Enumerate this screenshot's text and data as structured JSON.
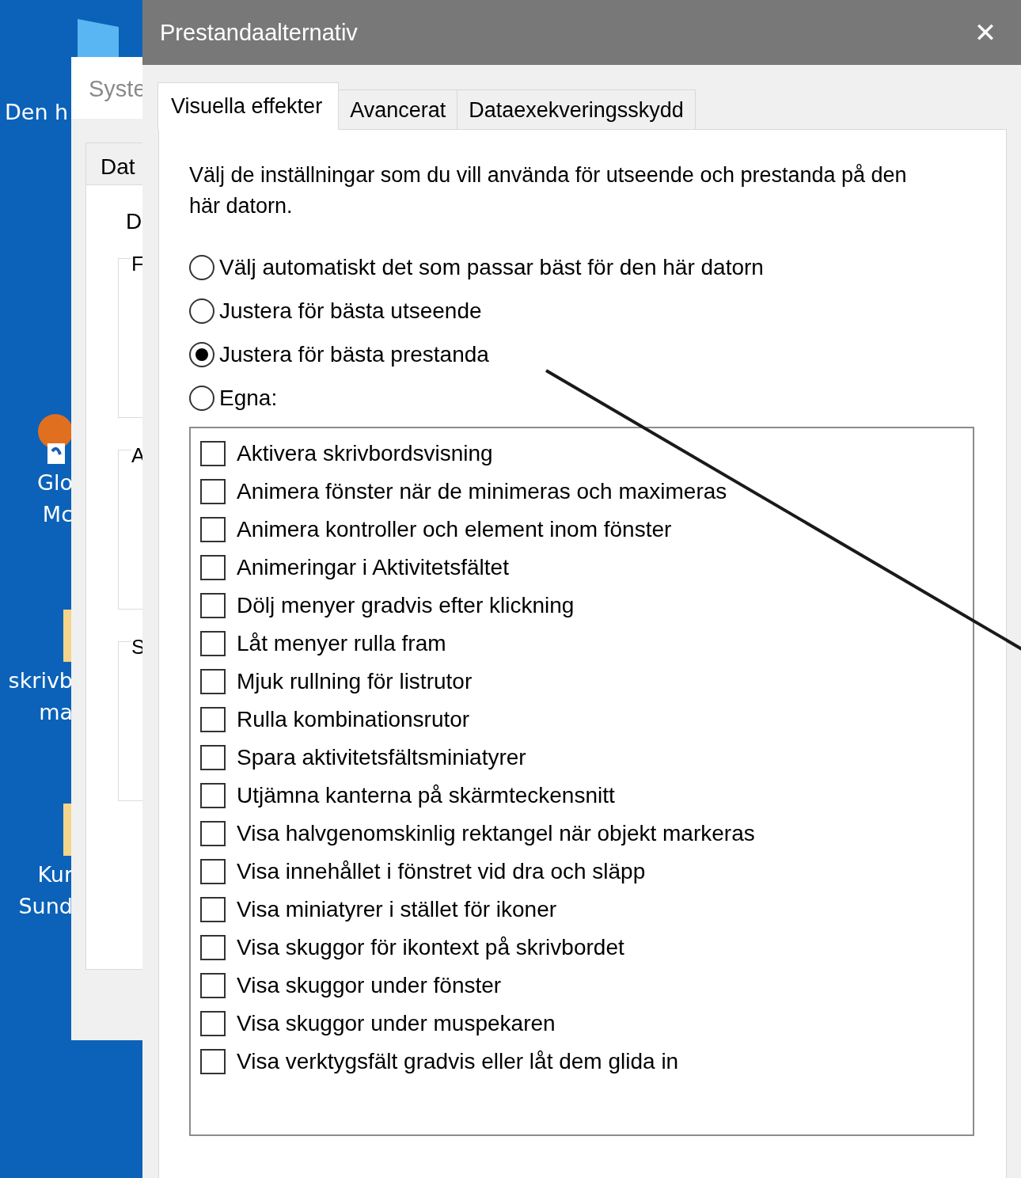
{
  "desktop": {
    "icons": [
      {
        "label": "Den h",
        "kind": "pc"
      },
      {
        "label": "Glo\nMc",
        "kind": "app"
      },
      {
        "label": "skrivb\nma",
        "kind": "folder"
      },
      {
        "label": "Kur\nSund",
        "kind": "folder"
      }
    ]
  },
  "background_window": {
    "title": "Syste",
    "tab": "Dat",
    "heading": "D",
    "groups": [
      "F",
      "A",
      "S"
    ]
  },
  "dialog": {
    "title": "Prestandaalternativ",
    "close": "✕",
    "tabs": [
      {
        "label": "Visuella effekter",
        "selected": true
      },
      {
        "label": "Avancerat",
        "selected": false
      },
      {
        "label": "Dataexekveringsskydd",
        "selected": false
      }
    ],
    "intro": "Välj de inställningar som du vill använda för utseende och prestanda på den här datorn.",
    "options": [
      {
        "label": "Välj automatiskt det som passar bäst för den här datorn",
        "selected": false
      },
      {
        "label": "Justera för bästa utseende",
        "selected": false
      },
      {
        "label": "Justera för bästa prestanda",
        "selected": true
      },
      {
        "label": "Egna:",
        "selected": false
      }
    ],
    "effects": [
      {
        "label": "Aktivera skrivbordsvisning",
        "checked": false
      },
      {
        "label": "Animera fönster när de minimeras och maximeras",
        "checked": false
      },
      {
        "label": "Animera kontroller och element inom fönster",
        "checked": false
      },
      {
        "label": "Animeringar i Aktivitetsfältet",
        "checked": false
      },
      {
        "label": "Dölj menyer gradvis efter klickning",
        "checked": false
      },
      {
        "label": "Låt menyer rulla fram",
        "checked": false
      },
      {
        "label": "Mjuk rullning för listrutor",
        "checked": false
      },
      {
        "label": "Rulla kombinationsrutor",
        "checked": false
      },
      {
        "label": "Spara aktivitetsfältsminiatyrer",
        "checked": false
      },
      {
        "label": "Utjämna kanterna på skärmteckensnitt",
        "checked": false
      },
      {
        "label": "Visa halvgenomskinlig rektangel när objekt markeras",
        "checked": false
      },
      {
        "label": "Visa innehållet i fönstret vid dra och släpp",
        "checked": false
      },
      {
        "label": "Visa miniatyrer i stället för ikoner",
        "checked": false
      },
      {
        "label": "Visa skuggor för ikontext på skrivbordet",
        "checked": false
      },
      {
        "label": "Visa skuggor under fönster",
        "checked": false
      },
      {
        "label": "Visa skuggor under muspekaren",
        "checked": false
      },
      {
        "label": "Visa verktygsfält gradvis eller låt dem glida in",
        "checked": false
      }
    ]
  }
}
